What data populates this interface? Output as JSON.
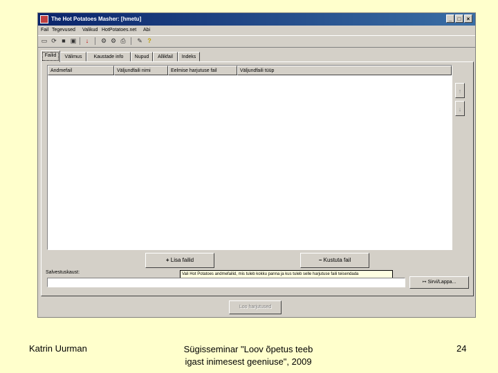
{
  "window": {
    "title": "The Hot Potatoes Masher: [hmetu]",
    "buttons": {
      "minimize": "_",
      "maximize": "□",
      "close": "×"
    }
  },
  "menu": [
    "Fail",
    "Tegevused",
    "Valikud",
    "HotPotatoes.net",
    "Abi"
  ],
  "toolbar_icons": [
    "new-icon",
    "open-icon",
    "save-icon",
    "save-as-icon",
    "add-icon",
    "build-icon",
    "build-all-icon",
    "export-icon",
    "web-icon",
    "help-icon"
  ],
  "tabs": [
    "Failid",
    "Välimus",
    "Kaustade info",
    "Nupud",
    "Allikfail",
    "Indeks"
  ],
  "columns": [
    "Andmefail",
    "Väljundfaili nimi",
    "Eelmise harjutuse fail",
    "Väljundfaili tüüp"
  ],
  "side_buttons": {
    "up": "↑",
    "down": "↓"
  },
  "add_button": {
    "icon": "+",
    "label": "Lisa failid"
  },
  "remove_button": {
    "icon": "−",
    "label": "Kustuta fail"
  },
  "output_label": "Salvestuskaust:",
  "output_value": "",
  "tooltip": "Vali Hot Potatoes andmefailid, mis tuleb kokku panna ja kus tuleb selle harjutuse faili teisendada",
  "browse_button": {
    "icon": "↦",
    "label": "Sirvi/Lappa..."
  },
  "build_button": "Loo harjutused",
  "footer": {
    "author": "Katrin Uurman",
    "event_line1": "Sügisseminar \"Loov õpetus teeb",
    "event_line2": "igast inimesest geeniuse\", 2009",
    "page_number": "24"
  },
  "colors": {
    "slide_bg": "#ffffcc",
    "window_bg": "#d4d0c8",
    "titlebar": "#0a246a"
  }
}
